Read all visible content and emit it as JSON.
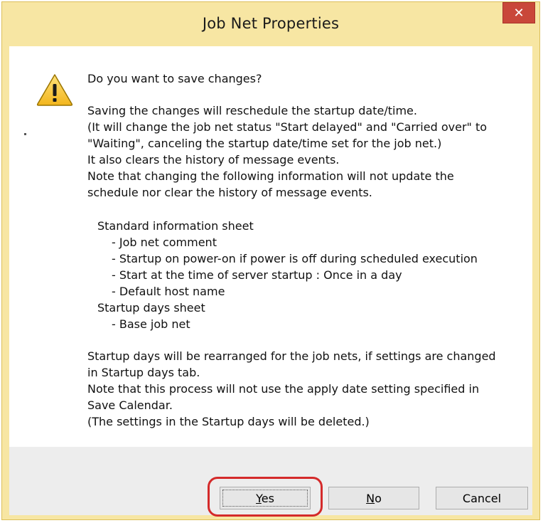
{
  "window": {
    "title": "Job Net Properties",
    "close_glyph": "✕"
  },
  "message": {
    "question": "Do you want to save changes?",
    "para1": [
      "Saving the changes will reschedule the startup date/time.",
      "(It will change the job net status \"Start delayed\" and \"Carried over\" to",
      "\"Waiting\", canceling the startup date/time set for the job net.)",
      "It also clears the history of message events.",
      "Note that changing the following information will not update the",
      "schedule nor clear the history of message events."
    ],
    "standard_sheet": {
      "heading": "Standard information sheet",
      "items": [
        "- Job net comment",
        "- Startup on power-on if power is off during scheduled execution",
        "- Start at the time of server startup : Once in a day",
        "- Default host name"
      ]
    },
    "startup_sheet": {
      "heading": "Startup days sheet",
      "items": [
        "- Base job net"
      ]
    },
    "para2": [
      "Startup days will be rearranged for the job nets, if settings are changed",
      "in Startup days tab.",
      "Note that this process will not use the apply date setting specified in",
      "Save Calendar.",
      "(The settings in the Startup days will be deleted.)"
    ]
  },
  "buttons": {
    "yes_mnemonic": "Y",
    "yes_rest": "es",
    "no_mnemonic": "N",
    "no_rest": "o",
    "cancel": "Cancel"
  },
  "icons": {
    "warning": "warning-icon",
    "close": "close-icon"
  },
  "colors": {
    "title_bar": "#f7e6a3",
    "close_button": "#c9473a",
    "highlight": "#d42a2a"
  }
}
